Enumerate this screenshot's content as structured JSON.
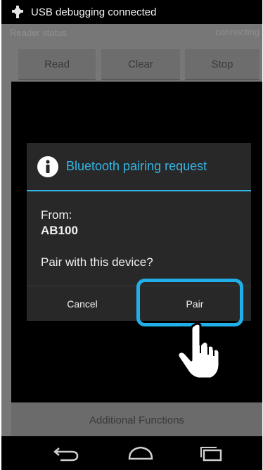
{
  "status_bar": {
    "text": "USB debugging connected",
    "icon": "usb-debug-icon"
  },
  "app": {
    "reader_label": "Reader status",
    "reader_state": "connecting",
    "buttons": {
      "read": "Read",
      "clear": "Clear",
      "stop": "Stop"
    },
    "additional_functions": "Additional Functions"
  },
  "dialog": {
    "title": "Bluetooth pairing request",
    "icon": "info-icon",
    "from_label": "From:",
    "device_name": "AB100",
    "question": "Pair with this device?",
    "cancel_label": "Cancel",
    "pair_label": "Pair"
  },
  "navigation": {
    "back": "back-icon",
    "home": "home-icon",
    "recent": "recent-apps-icon"
  },
  "colors": {
    "accent": "#33b5e5",
    "highlight": "#22aee8",
    "dialog_bg": "#282828"
  }
}
